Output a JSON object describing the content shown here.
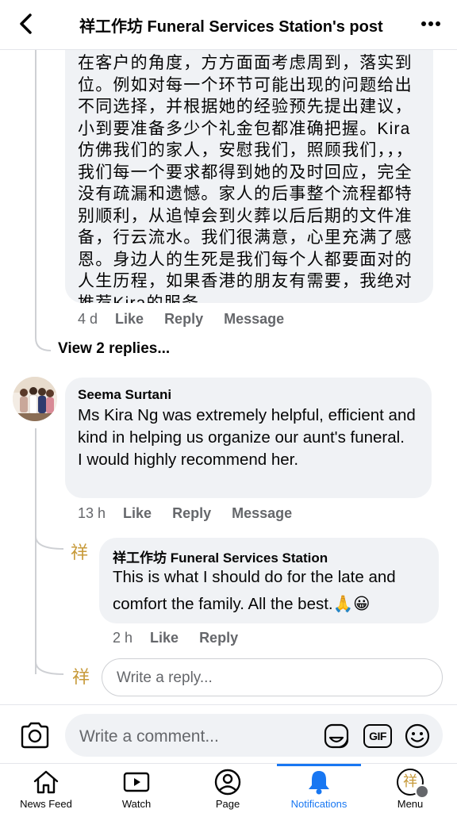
{
  "header": {
    "title": "祥工作坊 Funeral Services Station's post",
    "back_icon": "chevron-left-icon",
    "more_icon": "more-horizontal-icon"
  },
  "comment1": {
    "text": "在客户的角度，方方面面考虑周到，落实到位。例如对每一个环节可能出现的问题给出不同选择，并根据她的经验预先提出建议，小到要准备多少个礼金包都准确把握。Kira仿佛我们的家人，安慰我们，照顾我们，，，我们每一个要求都得到她的及时回应，完全没有疏漏和遗憾。家人的后事整个流程都特别顺利，从追悼会到火葬以后后期的文件准备，行云流水。我们很满意，心里充满了感恩。身边人的生死是我们每个人都要面对的人生历程，如果香港的朋友有需要，我绝对推荐Kira的服务。",
    "time": "4 d",
    "like": "Like",
    "reply": "Reply",
    "message": "Message",
    "view_replies": "View 2 replies..."
  },
  "comment2": {
    "author": "Seema Surtani",
    "text": "Ms Kira Ng was extremely helpful, efficient and kind in helping us organize our aunt's funeral.\nI would highly recommend her.",
    "time": "13 h",
    "like": "Like",
    "reply": "Reply",
    "message": "Message"
  },
  "page_reply": {
    "avatar_glyph": "祥",
    "author": "祥工作坊 Funeral Services Station",
    "text": "This is what I should do for the late and comfort the family. All the best.🙏😀",
    "time": "2 h",
    "like": "Like",
    "reply": "Reply"
  },
  "reply_input": {
    "placeholder": "Write a reply..."
  },
  "composer": {
    "placeholder": "Write a comment...",
    "gif_label": "GIF"
  },
  "nav": {
    "items": [
      {
        "label": "News Feed",
        "icon": "home-icon"
      },
      {
        "label": "Watch",
        "icon": "video-icon"
      },
      {
        "label": "Page",
        "icon": "profile-icon"
      },
      {
        "label": "Notifications",
        "icon": "bell-icon"
      },
      {
        "label": "Menu",
        "icon": "menu-avatar-icon"
      }
    ],
    "active": "Notifications"
  },
  "colors": {
    "accent": "#1877f2",
    "bubble": "#f0f2f5",
    "secondary_text": "#65676b",
    "gold": "#c79a3a"
  }
}
